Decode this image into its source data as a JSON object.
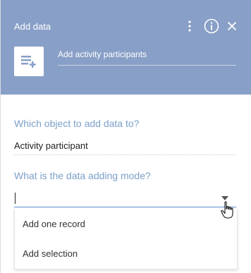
{
  "header": {
    "title": "Add data",
    "element_caption": "Add activity participants",
    "icons": [
      "more-vertical-icon",
      "info-icon",
      "close-icon",
      "add-data-icon"
    ]
  },
  "fields": {
    "object_label": "Which object to add data to?",
    "object_value": "Activity participant",
    "mode_label": "What is the data adding mode?",
    "mode_value": ""
  },
  "dropdown": {
    "options": [
      "Add one record",
      "Add selection"
    ]
  },
  "colors": {
    "header_bg": "#889fc7",
    "label_color": "#7d9fc8",
    "focus_line": "#5f8fca"
  }
}
